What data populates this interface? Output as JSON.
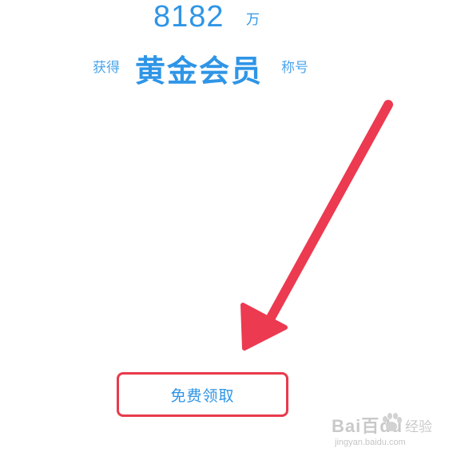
{
  "stat": {
    "number": "8182",
    "unit": "万"
  },
  "title": {
    "prefix": "获得",
    "main": "黄金会员",
    "suffix": "称号"
  },
  "claim_button": {
    "label": "免费领取"
  },
  "watermark": {
    "brand": "Bai百du",
    "sub": "经验",
    "url": "jingyan.baidu.com"
  },
  "colors": {
    "accent_blue": "#2f95e6",
    "highlight_red": "#e93a4c"
  },
  "icons": {
    "arrow": "red-arrow-icon",
    "paw": "paw-icon"
  }
}
